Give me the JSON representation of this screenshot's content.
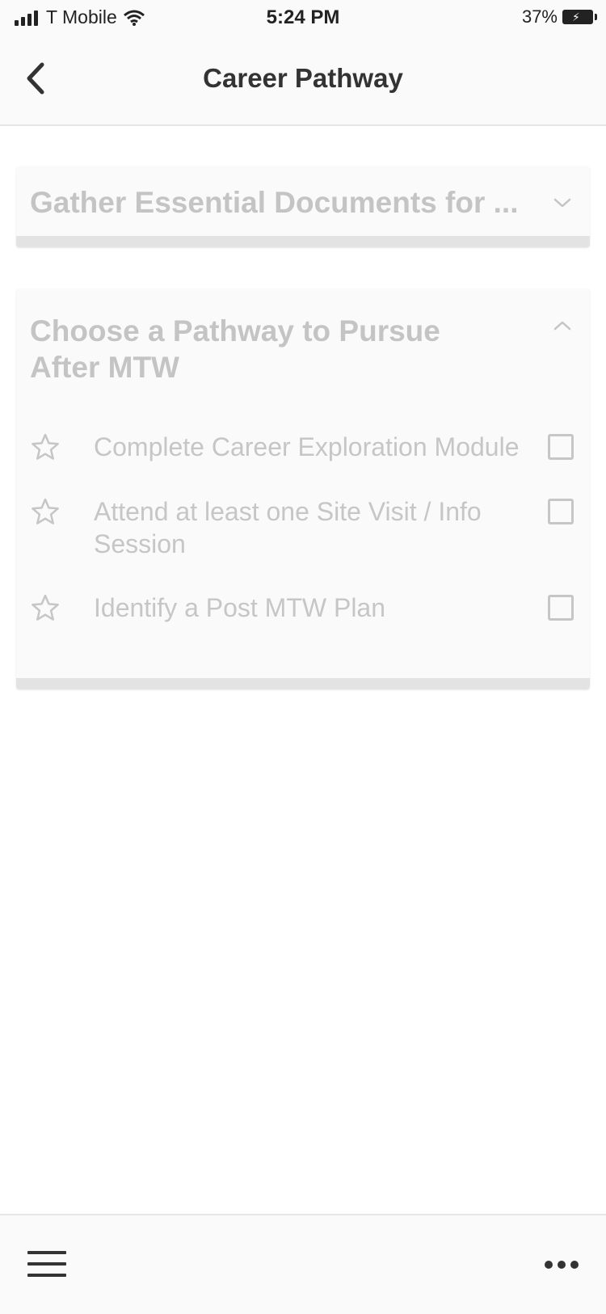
{
  "status_bar": {
    "carrier": "T Mobile",
    "time": "5:24 PM",
    "battery": "37%"
  },
  "header": {
    "title": "Career Pathway",
    "back_icon": "chevron-left-icon"
  },
  "sections": [
    {
      "title": "Gather Essential Documents for ...",
      "expanded": false,
      "toggle_icon": "chevron-down-icon"
    },
    {
      "title": "Choose a Pathway to Pursue After MTW",
      "expanded": true,
      "toggle_icon": "chevron-up-icon",
      "tasks": [
        {
          "label": "Complete Career Exploration Module",
          "checked": false,
          "icon": "star-outline-icon"
        },
        {
          "label": "Attend at least one Site Visit / Info Session",
          "checked": false,
          "icon": "star-outline-icon"
        },
        {
          "label": "Identify a Post MTW Plan",
          "checked": false,
          "icon": "star-outline-icon"
        }
      ]
    }
  ],
  "footer": {
    "menu_icon": "hamburger-menu-icon",
    "more_icon": "more-dots-icon"
  },
  "colors": {
    "disabled_text": "#c4c4c4",
    "header_bg": "#fafafa",
    "card_bg": "#fafafa",
    "card_border": "#e3e3e3"
  }
}
